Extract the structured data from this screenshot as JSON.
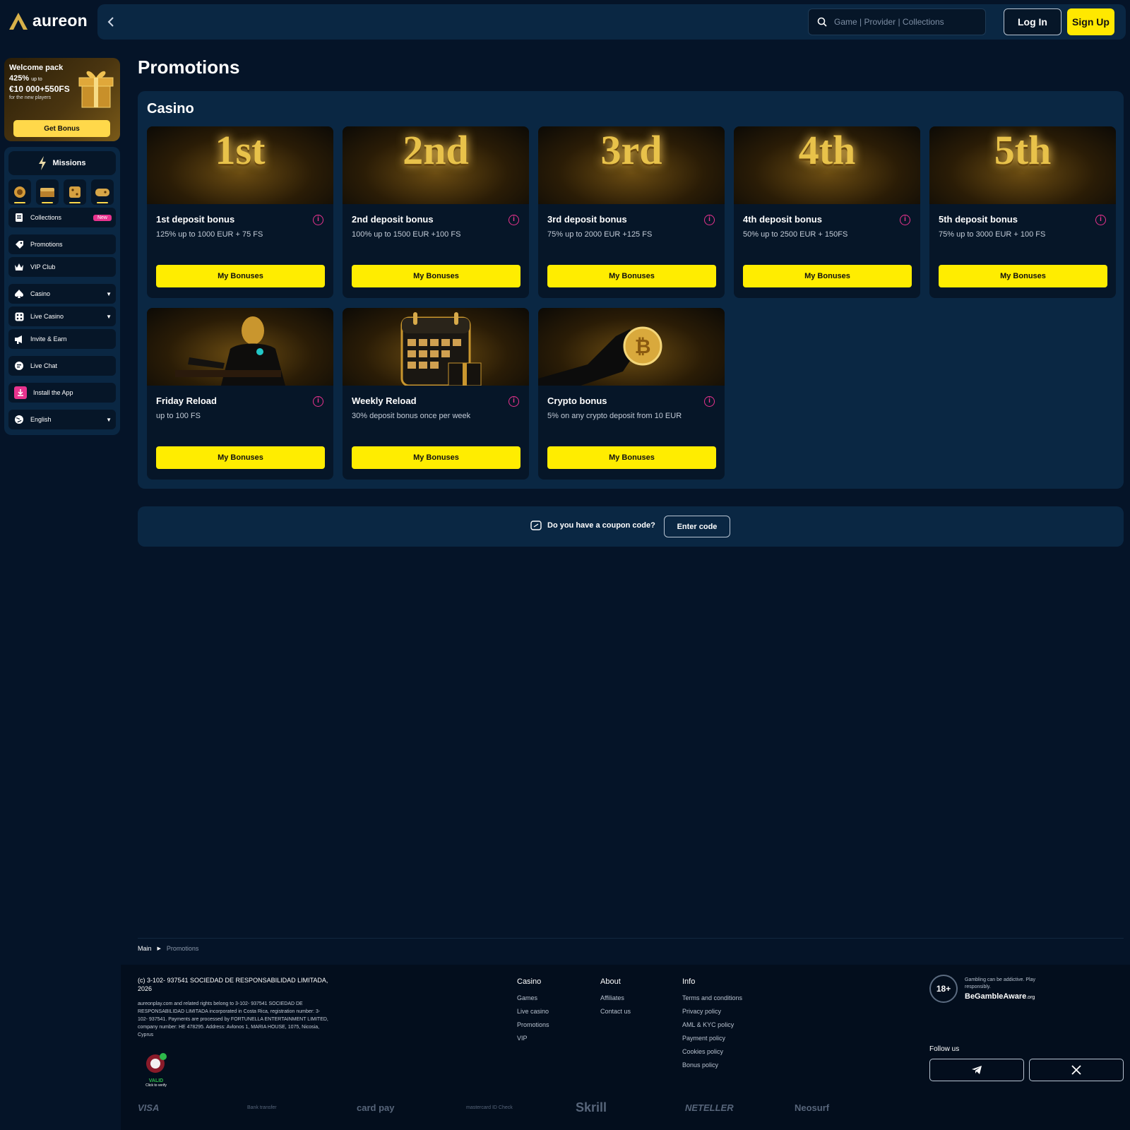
{
  "header": {
    "brand": "aureon",
    "search_placeholder": "Game | Provider | Collections",
    "login_label": "Log In",
    "signup_label": "Sign Up"
  },
  "welcome": {
    "title": "Welcome pack",
    "percent": "425%",
    "percent_suffix": "up to",
    "amount": "€10 000+550FS",
    "subtitle": "for the new players",
    "cta": "Get Bonus"
  },
  "sidebar": {
    "missions_label": "Missions",
    "items": [
      {
        "label": "Collections",
        "badge": "New",
        "icon": "collections-icon"
      },
      {
        "label": "Promotions",
        "icon": "promotions-icon"
      },
      {
        "label": "VIP Club",
        "icon": "crown-icon"
      },
      {
        "label": "Casino",
        "icon": "spade-icon",
        "expandable": true
      },
      {
        "label": "Live Casino",
        "icon": "dice-icon",
        "expandable": true
      },
      {
        "label": "Invite & Earn",
        "icon": "megaphone-icon"
      },
      {
        "label": "Live Chat",
        "icon": "chat-icon"
      },
      {
        "label": "Install the App",
        "icon": "download-icon"
      },
      {
        "label": "English",
        "icon": "globe-icon",
        "expandable": true
      }
    ]
  },
  "page": {
    "title": "Promotions",
    "section_title": "Casino"
  },
  "promotions": [
    {
      "image_text": "1st",
      "title": "1st deposit bonus",
      "desc": "125% up to 1000 EUR + 75 FS",
      "cta": "My Bonuses"
    },
    {
      "image_text": "2nd",
      "title": "2nd deposit bonus",
      "desc": "100% up to 1500 EUR +100 FS",
      "cta": "My Bonuses"
    },
    {
      "image_text": "3rd",
      "title": "3rd deposit bonus",
      "desc": "75% up to 2000 EUR +125 FS",
      "cta": "My Bonuses"
    },
    {
      "image_text": "4th",
      "title": "4th deposit bonus",
      "desc": "50% up to 2500 EUR + 150FS",
      "cta": "My Bonuses"
    },
    {
      "image_text": "5th",
      "title": "5th deposit bonus",
      "desc": "75% up to 3000 EUR + 100 FS",
      "cta": "My Bonuses"
    },
    {
      "image_text": "",
      "title": "Friday Reload",
      "desc": "up to 100 FS",
      "cta": "My Bonuses"
    },
    {
      "image_text": "",
      "title": "Weekly Reload",
      "desc": "30% deposit bonus once per week",
      "cta": "My Bonuses"
    },
    {
      "image_text": "",
      "title": "Crypto bonus",
      "desc": "5% on any crypto deposit from 10 EUR",
      "cta": "My Bonuses"
    }
  ],
  "coupon": {
    "question": "Do you have a coupon code?",
    "cta": "Enter code"
  },
  "breadcrumb": [
    "Main",
    "Promotions"
  ],
  "footer": {
    "copyright": "(c) 3-102- 937541 SOCIEDAD DE RESPONSABILIDAD LIMITADA, 2026",
    "legal": "aureonplay.com and related rights belong to 3-102- 937541 SOCIEDAD DE RESPONSABILIDAD LIMITADA incorporated in Costa Rica, registration number: 3-102- 937541. Payments are processed by FORTUNELLA ENTERTAINMENT LIMITED, company number: HE 478295. Address: Avlonos 1, MARIA HOUSE, 1075, Nicosia, Cyprus",
    "seal_label": "VALID",
    "seal_sub": "Click to verify",
    "columns": [
      {
        "heading": "Casino",
        "items": [
          "Games",
          "Live casino",
          "Promotions",
          "VIP"
        ]
      },
      {
        "heading": "About",
        "items": [
          "Affiliates",
          "Contact us"
        ]
      },
      {
        "heading": "Info",
        "items": [
          "Terms and conditions",
          "Privacy policy",
          "AML & KYC policy",
          "Payment policy",
          "Cookies policy",
          "Bonus policy"
        ]
      }
    ],
    "age": "18+",
    "gamble_text": "Gambling can be addictive. Play responsibly.",
    "gamble_brand": "BeGambleAware",
    "gamble_brand_suffix": ".org",
    "follow_label": "Follow us",
    "payments": [
      "VISA",
      "Bank transfer",
      "card pay",
      "mastercard ID Check",
      "Skrill",
      "NETELLER",
      "Neosurf"
    ]
  },
  "colors": {
    "accent": "#ffed00",
    "badge": "#e8338e",
    "panel": "#0a2743",
    "bg": "#051428"
  }
}
